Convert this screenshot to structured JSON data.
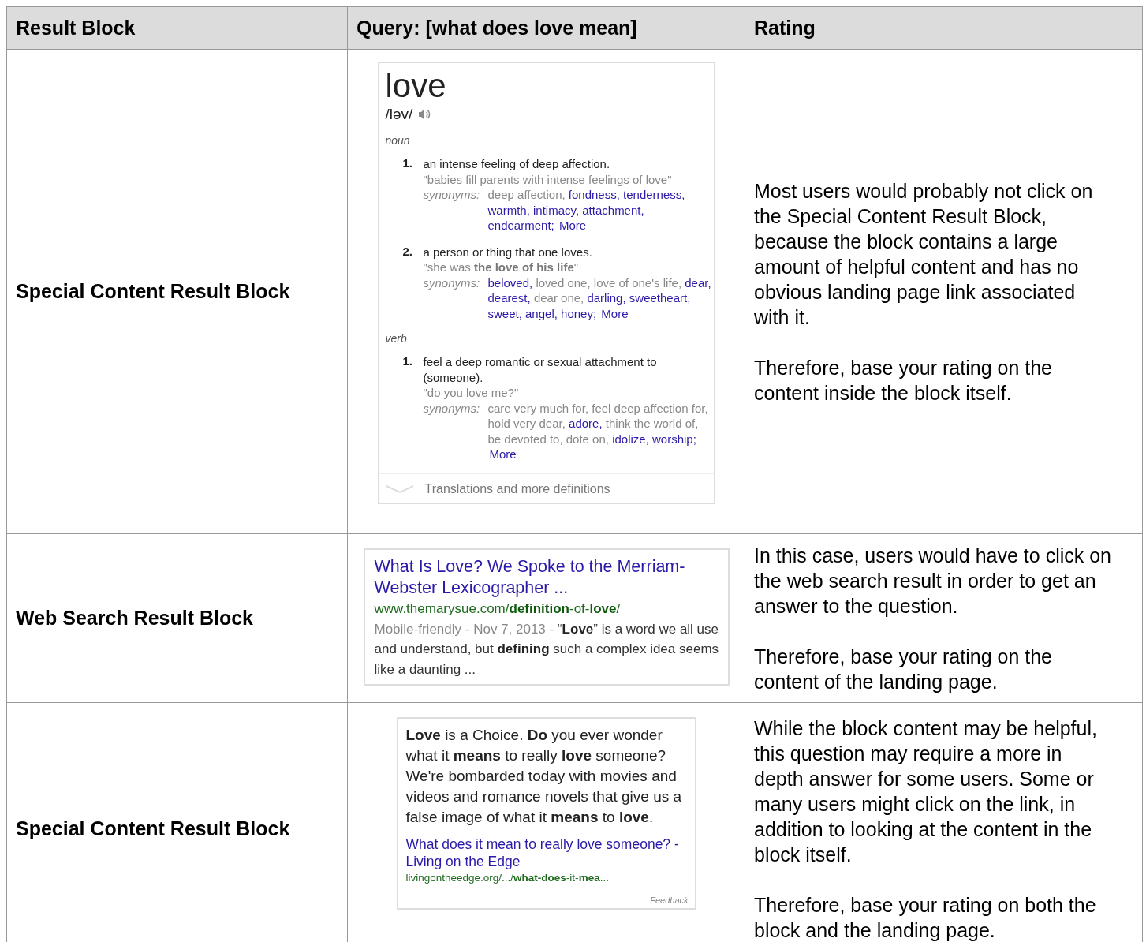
{
  "table": {
    "columns": [
      "Result Block",
      "Query: [what does love mean]",
      "Rating"
    ],
    "rows": [
      {
        "label": "Special Content Result Block",
        "block": {
          "kind": "dictionary",
          "word": "love",
          "pronunciation": "/ləv/",
          "parts": [
            {
              "pos": "noun",
              "senses": [
                {
                  "number": "1.",
                  "definition": "an intense feeling of deep affection.",
                  "example": "\"babies fill parents with intense feelings of love\"",
                  "synonyms_label": "synonyms:",
                  "synonyms": [
                    {
                      "text": "deep affection,",
                      "link": false
                    },
                    {
                      "text": "fondness,",
                      "link": true
                    },
                    {
                      "text": "tenderness,",
                      "link": true
                    },
                    {
                      "text": "warmth,",
                      "link": true
                    },
                    {
                      "text": "intimacy,",
                      "link": true
                    },
                    {
                      "text": "attachment,",
                      "link": true
                    },
                    {
                      "text": "endearment;",
                      "link": true
                    }
                  ],
                  "more": "More"
                },
                {
                  "number": "2.",
                  "definition": "a person or thing that one loves.",
                  "example": "\"she was **the love of his life**\"",
                  "synonyms_label": "synonyms:",
                  "synonyms": [
                    {
                      "text": "beloved,",
                      "link": true
                    },
                    {
                      "text": "loved one,",
                      "link": false
                    },
                    {
                      "text": "love of one's life,",
                      "link": false
                    },
                    {
                      "text": "dear,",
                      "link": true
                    },
                    {
                      "text": "dearest,",
                      "link": true
                    },
                    {
                      "text": "dear one,",
                      "link": false
                    },
                    {
                      "text": "darling,",
                      "link": true
                    },
                    {
                      "text": "sweetheart,",
                      "link": true
                    },
                    {
                      "text": "sweet,",
                      "link": true
                    },
                    {
                      "text": "angel,",
                      "link": true
                    },
                    {
                      "text": "honey;",
                      "link": true
                    }
                  ],
                  "more": "More"
                }
              ]
            },
            {
              "pos": "verb",
              "senses": [
                {
                  "number": "1.",
                  "definition": "feel a deep romantic or sexual attachment to (someone).",
                  "example": "\"do you love me?\"",
                  "synonyms_label": "synonyms:",
                  "synonyms": [
                    {
                      "text": "care very much for,",
                      "link": false
                    },
                    {
                      "text": "feel deep affection for,",
                      "link": false
                    },
                    {
                      "text": "hold very dear,",
                      "link": false
                    },
                    {
                      "text": "adore,",
                      "link": true
                    },
                    {
                      "text": "think the world of,",
                      "link": false
                    },
                    {
                      "text": "be devoted to,",
                      "link": false
                    },
                    {
                      "text": "dote on,",
                      "link": false
                    },
                    {
                      "text": "idolize,",
                      "link": true
                    },
                    {
                      "text": "worship;",
                      "link": true
                    }
                  ],
                  "more": "More"
                }
              ]
            }
          ],
          "footer": "Translations and more definitions"
        },
        "rating": [
          "Most users would probably not click on the Special Content Result Block, because the block contains a large amount of helpful content and has no obvious landing page link associated with it.",
          "Therefore, base your rating on the content inside the block itself."
        ]
      },
      {
        "label": "Web Search Result Block",
        "block": {
          "kind": "web",
          "title": "What Is Love? We Spoke to the Merriam-Webster Lexicographer ...",
          "url": "www.themarysue.com/**definition**-of-**love**/",
          "meta": "Mobile-friendly - Nov 7, 2013 - ",
          "snippet": "“**Love**” is a word we all use and understand, but **defining** such a complex idea seems like a daunting ..."
        },
        "rating": [
          "In this case, users would have to click on the web search result in order to get an answer to the question.",
          "Therefore, base your rating on the content of the landing page."
        ]
      },
      {
        "label": "Special Content Result Block",
        "block": {
          "kind": "featured",
          "text": "**Love** is a Choice. **Do** you ever wonder what it **means** to really **love** someone? We're bombarded today with movies and videos and romance novels that give us a false image of what it **means** to **love**.",
          "title": "What does it mean to really love someone? - Living on the Edge",
          "url": "livingontheedge.org/.../**what-does**-it-**mea**...",
          "feedback": "Feedback"
        },
        "rating": [
          "While the block content may be helpful, this question may require a more in depth answer for some users.  Some or many users might click on the link, in addition to looking at the content in the block itself.",
          "Therefore, base your rating on both the block and the landing page."
        ]
      }
    ]
  }
}
